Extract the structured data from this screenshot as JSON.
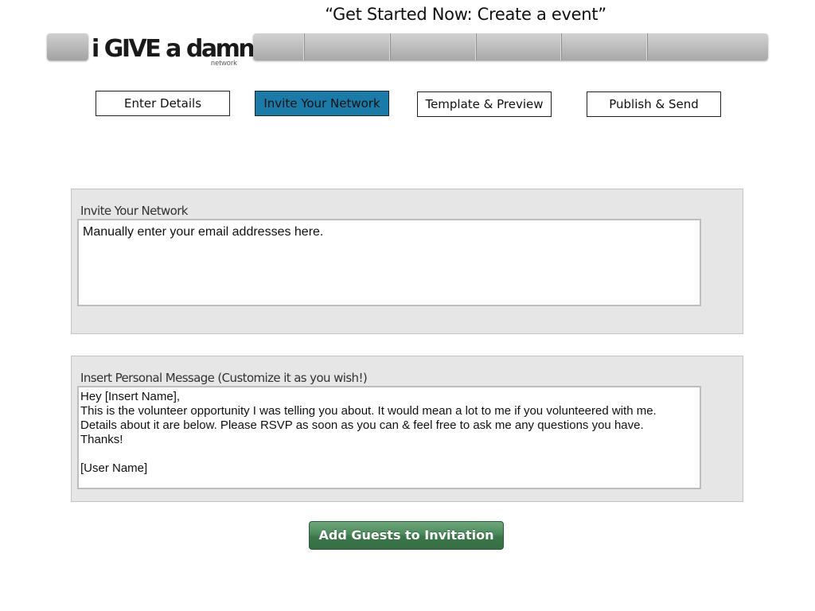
{
  "page": {
    "title": "“Get Started Now: Create a event”"
  },
  "logo": {
    "main": "i GIVE a damn",
    "bang": "!",
    "sub": "network"
  },
  "steps": [
    {
      "label": "Enter Details",
      "active": false
    },
    {
      "label": "Invite Your Network",
      "active": true
    },
    {
      "label": "Template & Preview",
      "active": false
    },
    {
      "label": "Publish & Send",
      "active": false
    }
  ],
  "invite_panel": {
    "label": "Invite Your Network",
    "value": "Manually enter your email addresses here."
  },
  "message_panel": {
    "label": "Insert Personal Message (Customize it as you wish!)",
    "lines": [
      "Hey [Insert Name],",
      "This is the volunteer opportunity I was telling you about. It would mean a lot to me if you volunteered with me.",
      "Details about it are below. Please RSVP as soon as you can & feel free to ask me any questions you have.",
      "Thanks!",
      "",
      "[User Name]"
    ]
  },
  "actions": {
    "add_guests": "Add Guests to Invitation"
  },
  "colors": {
    "active_step": "#1a7aa8",
    "panel_bg": "#e6e6e6",
    "button_green": "#4a8a5a",
    "logo_accent": "#2aa6cc"
  }
}
